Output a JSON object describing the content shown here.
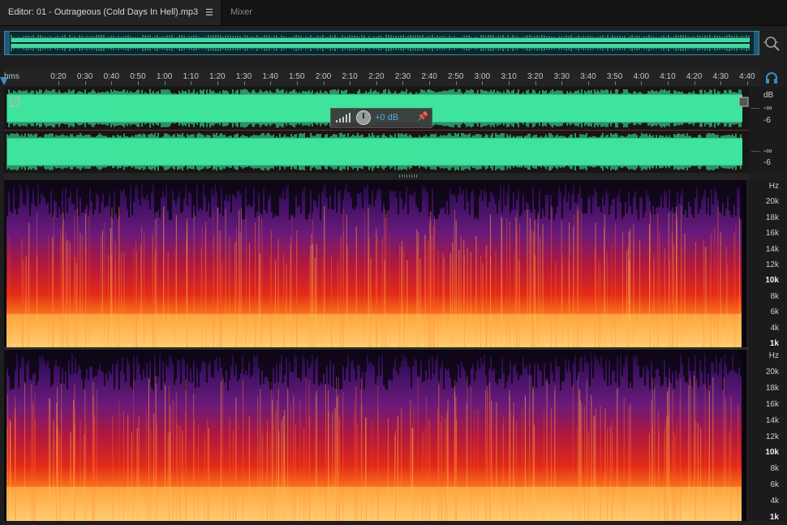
{
  "tabs": {
    "editor_label": "Editor: 01 - Outrageous (Cold Days In Hell).mp3",
    "menu_icon": "menu-icon",
    "mixer_label": "Mixer"
  },
  "overview": {
    "zoom_icon": "zoom-icon"
  },
  "ruler": {
    "unit": "hms",
    "ticks": [
      "0:20",
      "0:30",
      "0:40",
      "0:50",
      "1:00",
      "1:10",
      "1:20",
      "1:30",
      "1:40",
      "1:50",
      "2:00",
      "2:10",
      "2:20",
      "2:30",
      "2:40",
      "2:50",
      "3:00",
      "3:10",
      "3:20",
      "3:30",
      "3:40",
      "3:50",
      "4:00",
      "4:10",
      "4:20",
      "4:30",
      "4:40"
    ]
  },
  "waveform_scale": {
    "ch1": {
      "unit": "dB",
      "inf": "-∞",
      "minus6": "-6"
    },
    "ch2": {
      "inf": "-∞",
      "minus6": "-6"
    }
  },
  "hud": {
    "gain": "+0 dB"
  },
  "spectral_scale": {
    "ch1": [
      "Hz",
      "20k",
      "18k",
      "16k",
      "14k",
      "12k",
      "10k",
      "8k",
      "6k",
      "4k",
      "1k"
    ],
    "ch2": [
      "Hz",
      "20k",
      "18k",
      "16k",
      "14k",
      "12k",
      "10k",
      "8k",
      "6k",
      "4k",
      "1k"
    ]
  },
  "colors": {
    "waveform": "#3fe39d",
    "overview_wave": "#44d8a0",
    "accent": "#3d8ec6",
    "spec_low": "#ffd27a",
    "spec_mid": "#e0201a",
    "spec_high": "#5a1a8a"
  }
}
